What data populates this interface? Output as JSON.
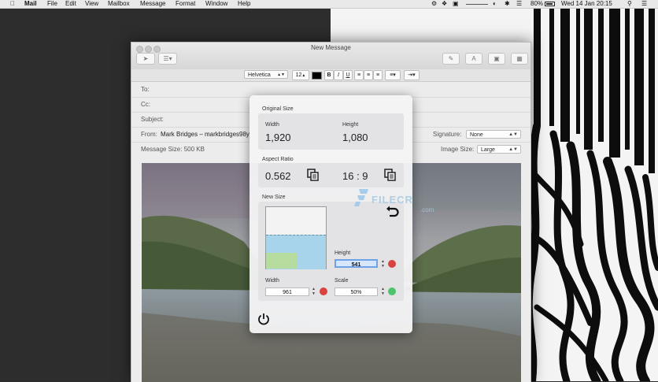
{
  "menubar": {
    "items": [
      "Mail",
      "File",
      "Edit",
      "View",
      "Mailbox",
      "Message",
      "Format",
      "Window",
      "Help"
    ],
    "battery": "80%",
    "clock": "Wed 14 Jan  20:15"
  },
  "mail": {
    "title": "New Message",
    "format": {
      "font": "Helvetica",
      "size": "12",
      "bold": "B",
      "italic": "I",
      "underline": "U"
    },
    "fields": {
      "to_label": "To:",
      "cc_label": "Cc:",
      "subject_label": "Subject:",
      "from_label": "From:",
      "from_value": "Mark Bridges – markbridges98y",
      "signature_label": "Signature:",
      "signature_value": "None",
      "message_size": "Message Size: 500 KB",
      "image_size_label": "Image Size:",
      "image_size_value": "Large"
    }
  },
  "popover": {
    "original": {
      "title": "Original Size",
      "width_label": "Width",
      "width_value": "1,920",
      "height_label": "Height",
      "height_value": "1,080"
    },
    "aspect": {
      "title": "Aspect Ratio",
      "decimal": "0.562",
      "ratio": "16 : 9"
    },
    "new_size": {
      "title": "New Size",
      "height_label": "Height",
      "height_value": "541",
      "width_label": "Width",
      "width_value": "961",
      "scale_label": "Scale",
      "scale_value": "50%"
    }
  },
  "colors": {
    "preview_blue": "#a7d4ea",
    "preview_green": "#b6dd9f",
    "lock_red": "#d9433f",
    "lock_green": "#4cc36d"
  },
  "watermark": {
    "text": "FILECR",
    "suffix": ".com"
  }
}
